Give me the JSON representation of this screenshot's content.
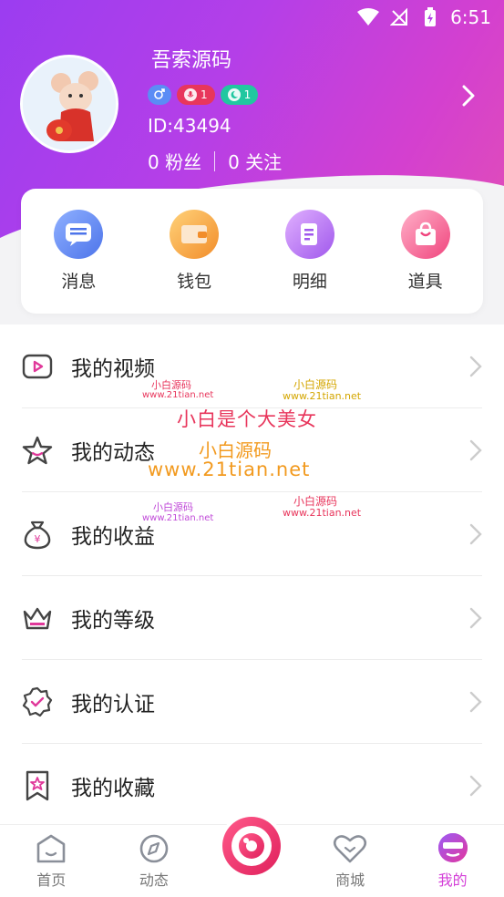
{
  "status_bar": {
    "time": "6:51"
  },
  "profile": {
    "username": "吾索源码",
    "badges": [
      {
        "icon": "male-icon",
        "text": "",
        "color": "#5b8cf5"
      },
      {
        "icon": "mic-icon",
        "text": "1",
        "color": "#e8365c"
      },
      {
        "icon": "moon-icon",
        "text": "1",
        "color": "#21c7a0"
      }
    ],
    "id_text": "ID:43494",
    "fans_text": "0 粉丝",
    "follows_text": "0 关注"
  },
  "quick_actions": [
    {
      "label": "消息",
      "icon": "message-icon",
      "color": "#5b82f0"
    },
    {
      "label": "钱包",
      "icon": "wallet-icon",
      "color": "#f5a13c"
    },
    {
      "label": "明细",
      "icon": "detail-icon",
      "color": "#b46af0"
    },
    {
      "label": "道具",
      "icon": "props-icon",
      "color": "#f04a8a"
    }
  ],
  "menu": [
    {
      "label": "我的视频",
      "icon": "video-icon"
    },
    {
      "label": "我的动态",
      "icon": "star-icon"
    },
    {
      "label": "我的收益",
      "icon": "money-bag-icon"
    },
    {
      "label": "我的等级",
      "icon": "crown-icon"
    },
    {
      "label": "我的认证",
      "icon": "verified-icon"
    },
    {
      "label": "我的收藏",
      "icon": "bookmark-icon"
    }
  ],
  "watermarks": {
    "cn_small": "小白源码",
    "url_small": "www.21tian.net",
    "slogan": "小白是个大美女",
    "big_cn": "小白源码",
    "big_url": "www.21tian.net"
  },
  "tabbar": [
    {
      "label": "首页",
      "icon": "home-icon",
      "active": false
    },
    {
      "label": "动态",
      "icon": "compass-icon",
      "active": false
    },
    {
      "label": "商城",
      "icon": "heart-icon",
      "active": false
    },
    {
      "label": "我的",
      "icon": "profile-icon",
      "active": true
    }
  ],
  "colors": {
    "accent": "#d43fd8",
    "header_start": "#9b3df0",
    "header_end": "#e24fb5"
  }
}
